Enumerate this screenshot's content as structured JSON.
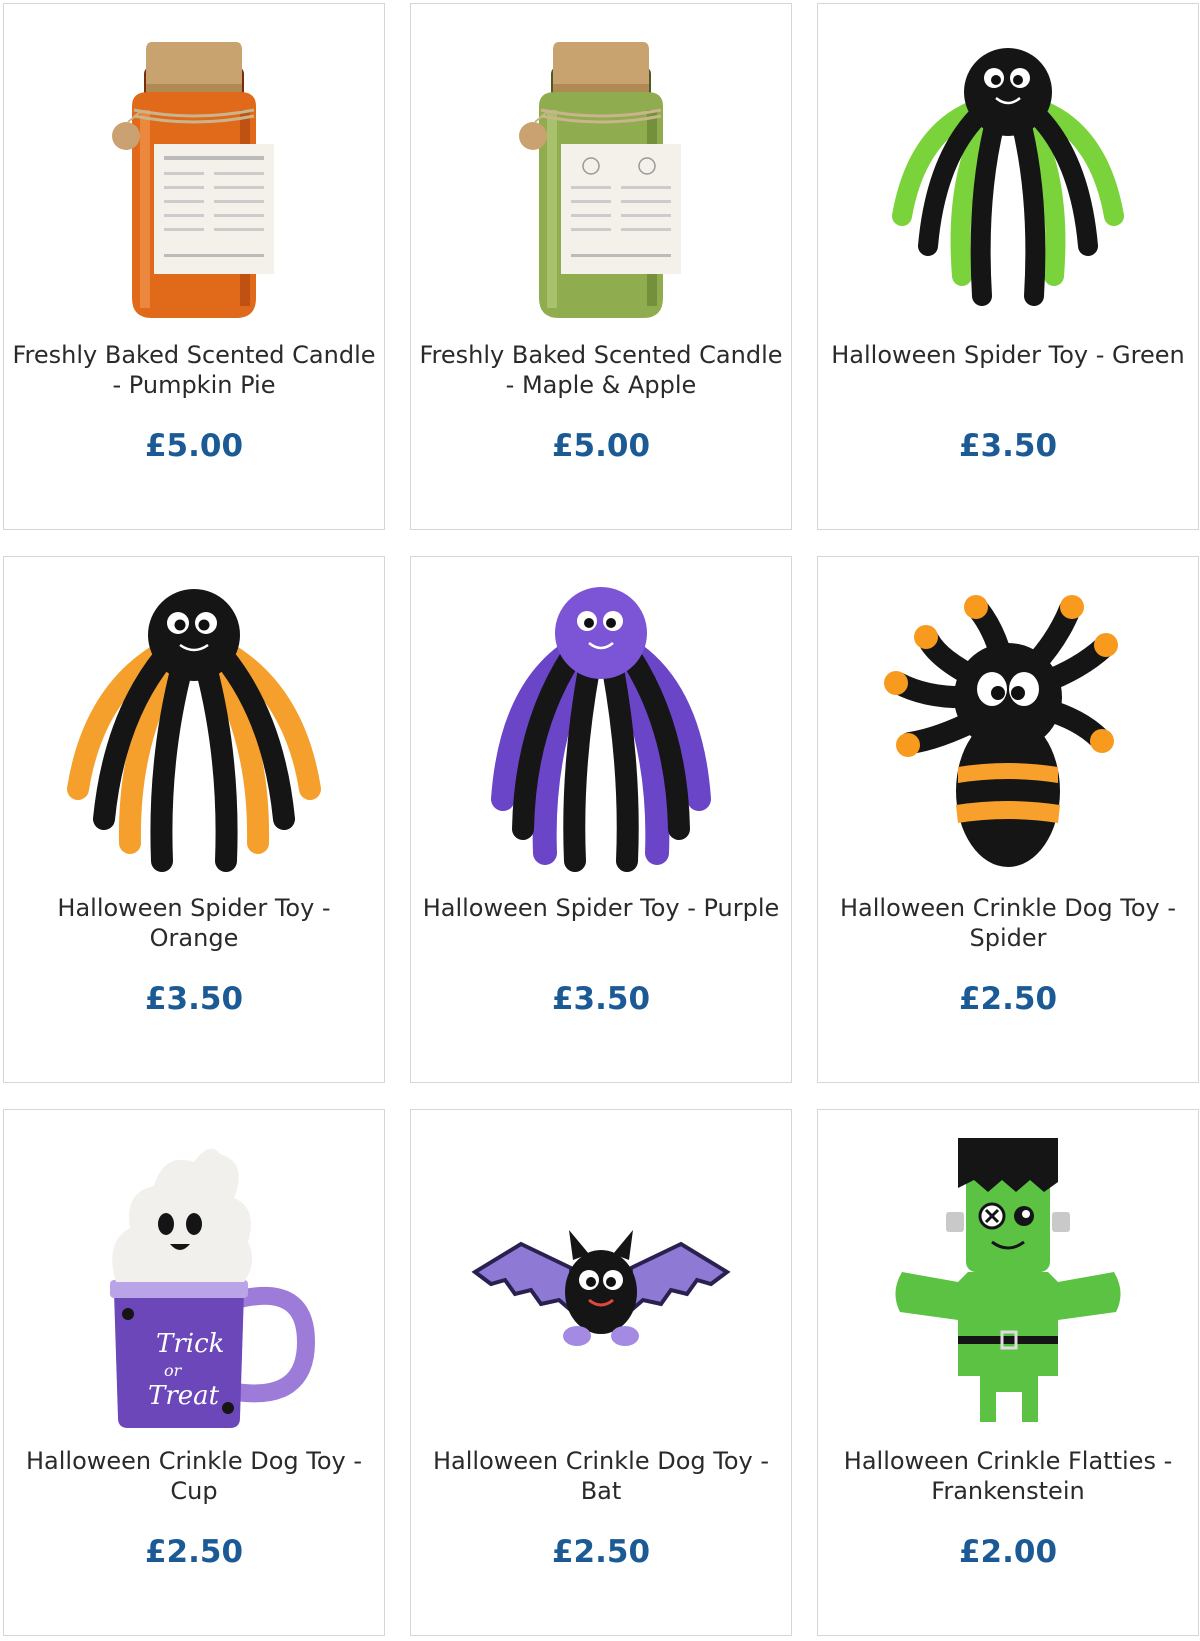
{
  "products": [
    {
      "name": "Freshly Baked Scented Candle - Pumpkin Pie",
      "price": "£5.00",
      "image_icon": "orange-candle-jar-icon"
    },
    {
      "name": "Freshly Baked Scented Candle - Maple & Apple",
      "price": "£5.00",
      "image_icon": "green-candle-jar-icon"
    },
    {
      "name": "Halloween Spider Toy - Green",
      "price": "£3.50",
      "image_icon": "green-spider-toy-icon"
    },
    {
      "name": "Halloween Spider Toy - Orange",
      "price": "£3.50",
      "image_icon": "orange-spider-toy-icon"
    },
    {
      "name": "Halloween Spider Toy - Purple",
      "price": "£3.50",
      "image_icon": "purple-spider-toy-icon"
    },
    {
      "name": "Halloween Crinkle Dog Toy - Spider",
      "price": "£2.50",
      "image_icon": "crinkle-spider-toy-icon"
    },
    {
      "name": "Halloween Crinkle Dog Toy - Cup",
      "price": "£2.50",
      "image_icon": "ghost-cup-toy-icon"
    },
    {
      "name": "Halloween Crinkle Dog Toy - Bat",
      "price": "£2.50",
      "image_icon": "bat-toy-icon"
    },
    {
      "name": "Halloween Crinkle Flatties - Frankenstein",
      "price": "£2.00",
      "image_icon": "frankenstein-toy-icon"
    }
  ],
  "mug_text": [
    "Trick",
    "or",
    "Treat"
  ],
  "colors": {
    "price": "#1b5a95",
    "title": "#2a2a2a",
    "card_border": "#d6d6d6"
  }
}
